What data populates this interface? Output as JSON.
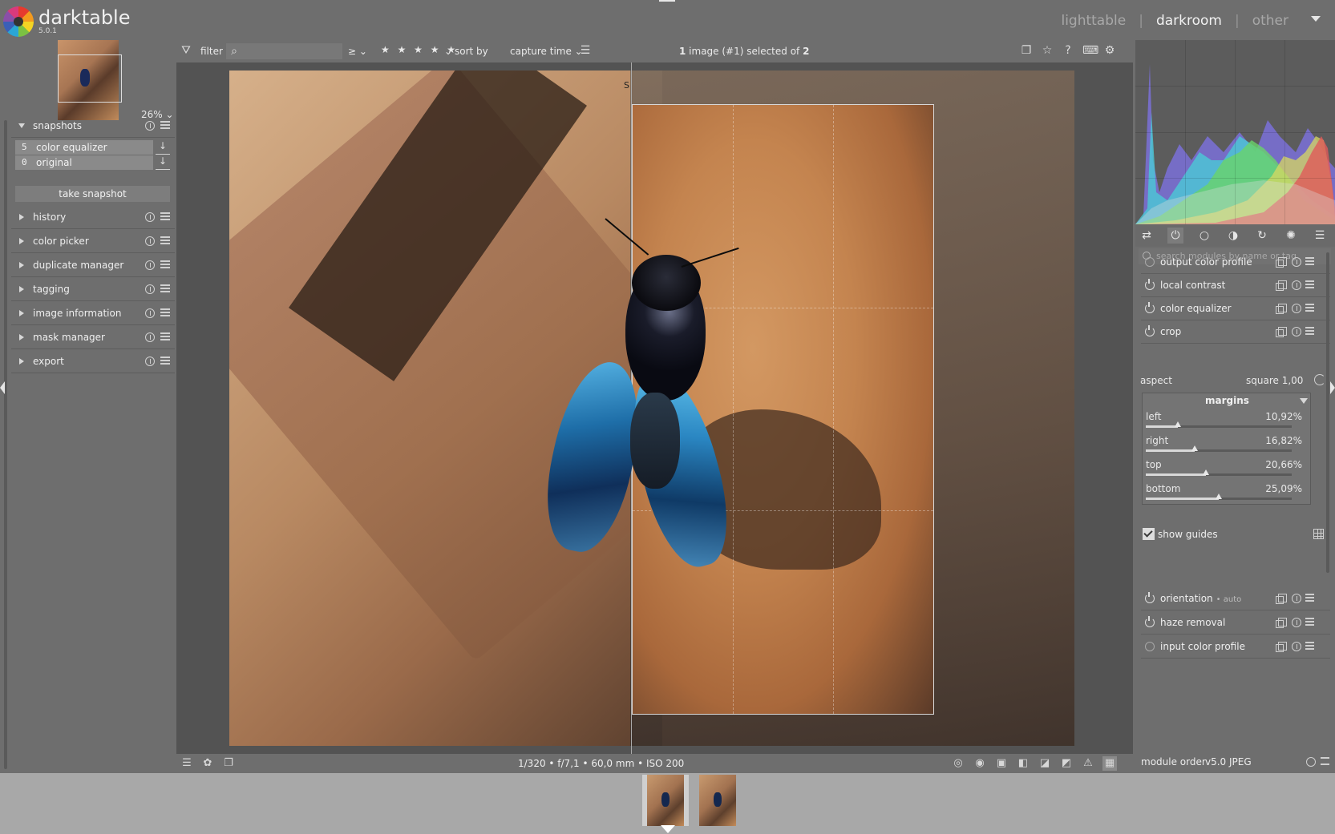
{
  "app": {
    "name": "darktable",
    "version": "5.0.1"
  },
  "views": {
    "lighttable": "lighttable",
    "darkroom": "darkroom",
    "other": "other",
    "separator": "|"
  },
  "navigation": {
    "zoom": "26%"
  },
  "left_modules": {
    "snapshots": {
      "label": "snapshots",
      "items": [
        {
          "num": "5",
          "name": "color equalizer"
        },
        {
          "num": "0",
          "name": "original"
        }
      ],
      "take": "take snapshot"
    },
    "history": "history",
    "color_picker": "color picker",
    "duplicate_manager": "duplicate manager",
    "tagging": "tagging",
    "image_information": "image information",
    "mask_manager": "mask manager",
    "export": "export"
  },
  "filterbar": {
    "filter_label": "filter",
    "rating_op": "≥",
    "stars": "★ ★ ★ ★ ★",
    "sort_label": "sort by",
    "sort_value": "capture time",
    "count_prefix": "1",
    "count_text": " image (#1) selected of ",
    "count_total": "2"
  },
  "image": {
    "snapshot_marker": "S"
  },
  "bottombar": {
    "exif": "1/320 • f/7,1 • 60,0 mm • ISO 200"
  },
  "right_modules": {
    "search_placeholder": "search modules by name or tag",
    "output_color_profile": "output color profile",
    "local_contrast": "local contrast",
    "color_equalizer": "color equalizer",
    "crop": "crop",
    "orientation": "orientation",
    "orientation_sub": "• auto",
    "haze_removal": "haze removal",
    "input_color_profile": "input color profile"
  },
  "crop": {
    "aspect_label": "aspect",
    "aspect_value": "square  1,00",
    "margins_title": "margins",
    "sliders": [
      {
        "name": "left",
        "value": "10,92%",
        "fraction": 0.1092
      },
      {
        "name": "right",
        "value": "16,82%",
        "fraction": 0.1682
      },
      {
        "name": "top",
        "value": "20,66%",
        "fraction": 0.2066
      },
      {
        "name": "bottom",
        "value": "25,09%",
        "fraction": 0.2509
      }
    ],
    "show_guides": "show guides"
  },
  "module_order": {
    "label": "module order",
    "value": "v5.0 JPEG"
  },
  "icons": {
    "search": "search-icon",
    "power": "power-icon",
    "info": "info-icon",
    "presets": "presets-icon",
    "multi_instance": "multi-instance-icon",
    "settings": "gear-icon",
    "star": "star-icon",
    "help": "help-icon"
  },
  "colors": {
    "panel": "#6e6e6e",
    "center": "#535353",
    "filmstrip": "#a8a8a8"
  }
}
